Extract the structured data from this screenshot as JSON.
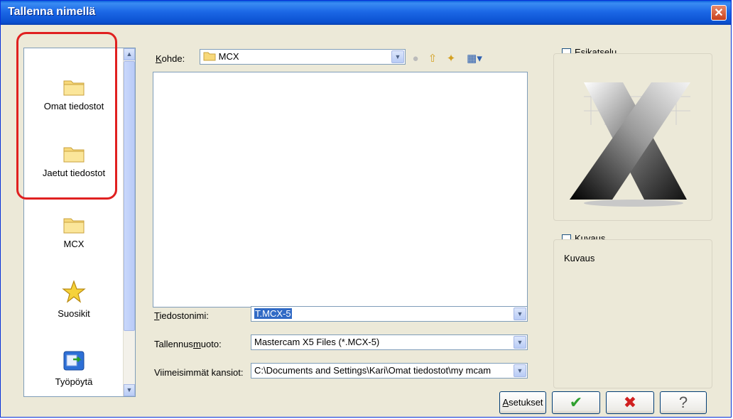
{
  "window": {
    "title": "Tallenna nimellä",
    "close_glyph": "✕"
  },
  "places": [
    {
      "label": "Omat tiedostot",
      "icon": "folder-icon"
    },
    {
      "label": "Jaetut tiedostot",
      "icon": "folder-icon"
    },
    {
      "label": "MCX",
      "icon": "folder-icon"
    },
    {
      "label": "Suosikit",
      "icon": "star-icon"
    },
    {
      "label": "Työpöytä",
      "icon": "desktop-icon"
    }
  ],
  "location": {
    "label": "Kohde:",
    "label_underline": "K",
    "label_rest": "ohde:",
    "value": "MCX"
  },
  "fields": {
    "filename": {
      "label_underline": "T",
      "label_rest": "iedostonimi:",
      "value": "T.MCX-5"
    },
    "filetype": {
      "label_pre": "Tallennus",
      "label_underline": "m",
      "label_rest": "uoto:",
      "value": "Mastercam X5 Files (*.MCX-5)"
    },
    "recent": {
      "label": "Viimeisimmät kansiot:",
      "value": "C:\\Documents and Settings\\Kari\\Omat tiedostot\\my mcam"
    }
  },
  "preview": {
    "checkbox_label": "Esikatselu"
  },
  "description": {
    "checkbox_label": "Kuvaus",
    "text": "Kuvaus"
  },
  "buttons": {
    "settings_underline": "A",
    "settings_rest": "setukset",
    "ok_glyph": "✔",
    "cancel_glyph": "✖",
    "help_glyph": "?"
  },
  "colors": {
    "ok": "#2fa02f",
    "cancel": "#d02020",
    "highlight": "#e02020"
  }
}
